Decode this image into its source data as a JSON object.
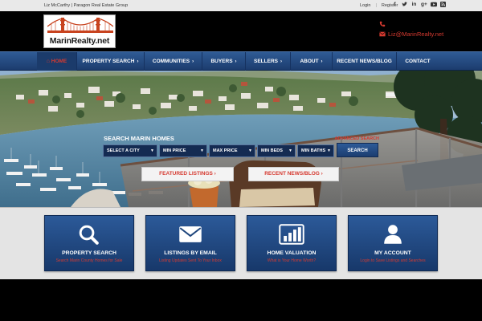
{
  "topbar": {
    "agent": "Liz McCarthy | Paragon Real Estate Group",
    "login": "Login",
    "register": "Register",
    "social_icons": [
      "facebook-icon",
      "twitter-icon",
      "linkedin-icon",
      "google-plus-icon",
      "youtube-icon",
      "rss-icon"
    ]
  },
  "header": {
    "logo_text": "MarinRealty.net",
    "email": "Liz@MarinRealty.net",
    "accent_color": "#d63a30"
  },
  "nav": {
    "home": "HOME",
    "property_search": "PROPERTY SEARCH",
    "communities": "COMMUNITIES",
    "buyers": "BUYERS",
    "sellers": "SELLERS",
    "about": "ABOUT",
    "news": "RECENT NEWS/BLOG",
    "contact": "CONTACT"
  },
  "search": {
    "title": "SEARCH MARIN HOMES",
    "advanced": "ADVANCED SEARCH",
    "city": "SELECT A CITY",
    "min_price": "MIN PRICE",
    "max_price": "MAX PRICE",
    "min_beds": "MIN BEDS",
    "min_baths": "MIN BATHS",
    "button": "SEARCH"
  },
  "hero_buttons": {
    "featured": "FEATURED LISTINGS ›",
    "news": "RECENT NEWS/BLOG ›"
  },
  "cards": [
    {
      "title": "PROPERTY SEARCH",
      "subtitle": "Search Marin County Homes for Sale",
      "icon": "magnifier-icon"
    },
    {
      "title": "LISTINGS BY EMAIL",
      "subtitle": "Listing Updates Sent To Your Inbox",
      "icon": "envelope-icon"
    },
    {
      "title": "HOME VALUATION",
      "subtitle": "What is Your Home Worth?",
      "icon": "bar-chart-icon"
    },
    {
      "title": "MY ACCOUNT",
      "subtitle": "Login to Save Listings and Searches",
      "icon": "user-icon"
    }
  ]
}
